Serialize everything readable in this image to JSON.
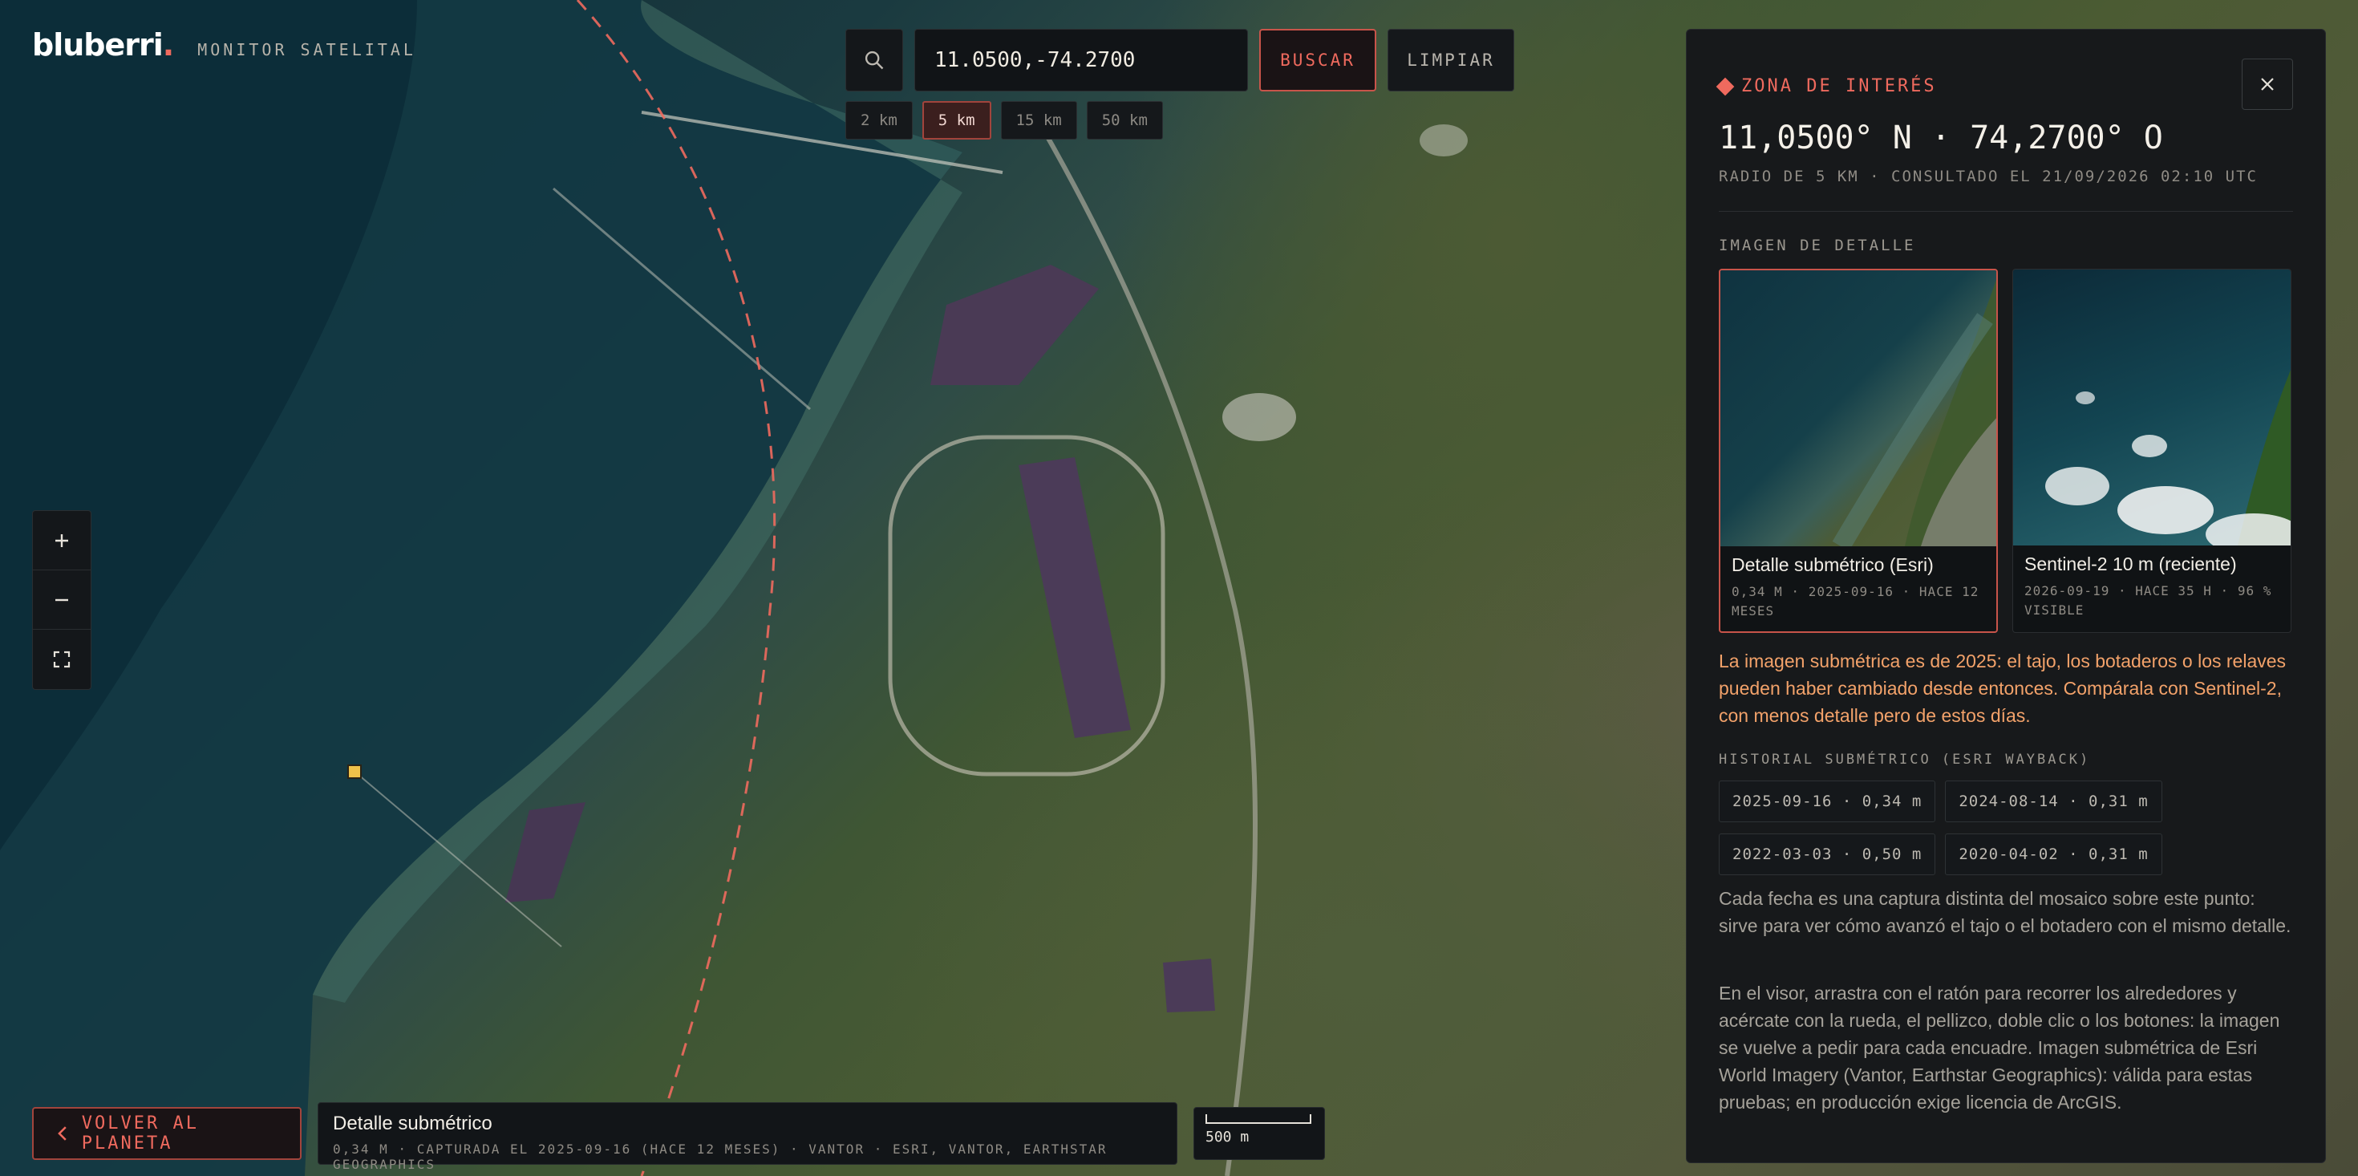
{
  "brand": {
    "logo": "bluberri",
    "logo_dot": ".",
    "subtitle": "MONITOR SATELITAL"
  },
  "search": {
    "value": "11.0500,-74.2700",
    "search_label": "BUSCAR",
    "clear_label": "LIMPIAR",
    "icon": "search-icon"
  },
  "radii": [
    {
      "label": "2 km",
      "active": false
    },
    {
      "label": "5 km",
      "active": true
    },
    {
      "label": "15 km",
      "active": false
    },
    {
      "label": "50 km",
      "active": false
    }
  ],
  "zoom": {
    "in_icon": "plus-icon",
    "out_icon": "minus-icon",
    "fullscreen_icon": "fullscreen-icon"
  },
  "bottom": {
    "back_label": "VOLVER AL PLANETA",
    "info_title": "Detalle submétrico",
    "info_sub": "0,34 M · CAPTURADA EL 2025-09-16 (HACE 12 MESES) · VANTOR · ESRI, VANTOR, EARTHSTAR GEOGRAPHICS",
    "scale_label": "500 m"
  },
  "panel": {
    "zone_label": "ZONA DE INTERÉS",
    "coords": "11,0500° N · 74,2700° O",
    "meta": "RADIO DE 5 KM · CONSULTADO EL 21/09/2026 02:10 UTC",
    "detail_heading": "IMAGEN DE DETALLE",
    "thumbs": [
      {
        "title": "Detalle submétrico (Esri)",
        "sub": "0,34 M · 2025-09-16 · HACE 12 MESES",
        "active": true
      },
      {
        "title": "Sentinel-2 10 m (reciente)",
        "sub": "2026-09-19 · HACE 35 H · 96 % VISIBLE",
        "active": false
      }
    ],
    "warning": "La imagen submétrica es de 2025: el tajo, los botaderos o los relaves pueden haber cambiado desde entonces. Compárala con Sentinel-2, con menos detalle pero de estos días.",
    "history_heading": "HISTORIAL SUBMÉTRICO (ESRI WAYBACK)",
    "history": [
      "2025-09-16 · 0,34 m",
      "2024-08-14 · 0,31 m",
      "2022-03-03 · 0,50 m",
      "2020-04-02 · 0,31 m"
    ],
    "para1": "Cada fecha es una captura distinta del mosaico sobre este punto: sirve para ver cómo avanzó el tajo o el botadero con el mismo detalle.",
    "para2": "En el visor, arrastra con el ratón para recorrer los alrededores y acércate con la rueda, el pellizco, doble clic o los botones: la imagen se vuelve a pedir para cada encuadre. Imagen submétrica de Esri World Imagery (Vantor, Earthstar Geographics): válida para estas pruebas; en producción exige licencia de ArcGIS."
  },
  "colors": {
    "accent": "#ef6a5e",
    "warning": "#f3a26a",
    "panel": "#17191b"
  }
}
